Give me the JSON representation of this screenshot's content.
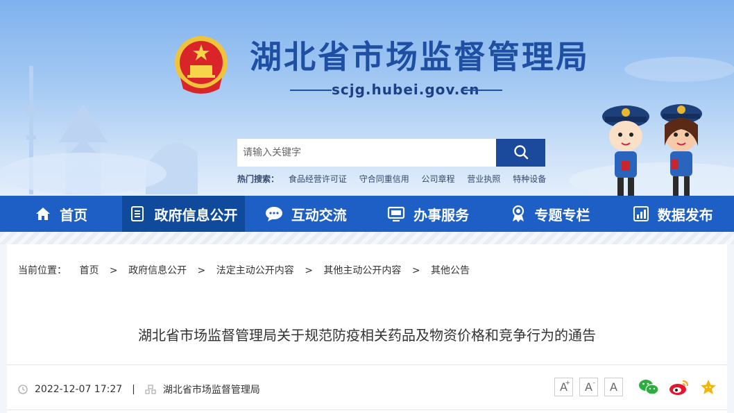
{
  "header": {
    "site_title": "湖北省市场监督管理局",
    "domain": "scjg.hubei.gov.cn",
    "search": {
      "placeholder": "请输入关键字"
    },
    "hot_search_label": "热门搜索：",
    "hot_links": [
      "食品经营许可证",
      "守合同重信用",
      "公司章程",
      "营业执照",
      "特种设备"
    ]
  },
  "nav": {
    "items": [
      {
        "label": "首页",
        "icon": "home-icon"
      },
      {
        "label": "政府信息公开",
        "icon": "document-list-icon",
        "active": true
      },
      {
        "label": "互动交流",
        "icon": "chat-bubble-icon"
      },
      {
        "label": "办事服务",
        "icon": "monitor-icon"
      },
      {
        "label": "专题专栏",
        "icon": "badge-icon"
      },
      {
        "label": "数据发布",
        "icon": "bar-chart-icon"
      }
    ]
  },
  "breadcrumb": {
    "label": "当前位置：",
    "items": [
      "首页",
      "政府信息公开",
      "法定主动公开内容",
      "其他主动公开内容",
      "其他公告"
    ],
    "separator": ">"
  },
  "article": {
    "title": "湖北省市场监督管理局关于规范防疫相关药品及物资价格和竞争行为的通告",
    "datetime": "2022-12-07 17:27",
    "meta_separator": "|",
    "source": "湖北省市场监督管理局"
  },
  "font_size_buttons": {
    "increase": "A",
    "increase_sup": "+",
    "decrease": "A",
    "decrease_sup": "-",
    "reset": "A"
  },
  "share_icons": [
    "wechat-icon",
    "weibo-icon",
    "favorite-star-icon"
  ],
  "colors": {
    "nav_bg": "#1d5fc4",
    "nav_active": "#104a9d",
    "title_blue": "#1e4fa3",
    "search_btn": "#1b4a9c"
  }
}
